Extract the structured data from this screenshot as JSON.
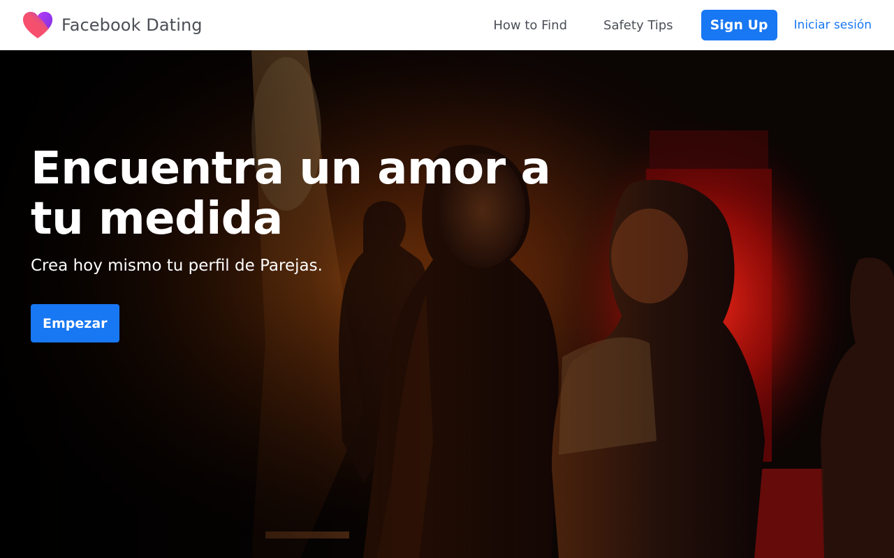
{
  "header": {
    "logo_icon": "heart-icon",
    "brand_name": "Facebook Dating",
    "nav": {
      "how_to_find": "How to Find",
      "safety_tips": "Safety Tips"
    },
    "signup_label": "Sign Up",
    "login_label": "Iniciar sesión"
  },
  "hero": {
    "title": "Encuentra un amor a tu medida",
    "subtitle": "Crea hoy mismo tu perfil de Parejas.",
    "cta_label": "Empezar",
    "image_alt": "Photo of people dancing in a dimly lit club with orange and red lights"
  },
  "colors": {
    "accent": "#1877f2",
    "header_bg": "#ffffff",
    "nav_text": "#4b4f56",
    "logo_gradient": [
      "#ff5b7a",
      "#a033ff"
    ]
  }
}
